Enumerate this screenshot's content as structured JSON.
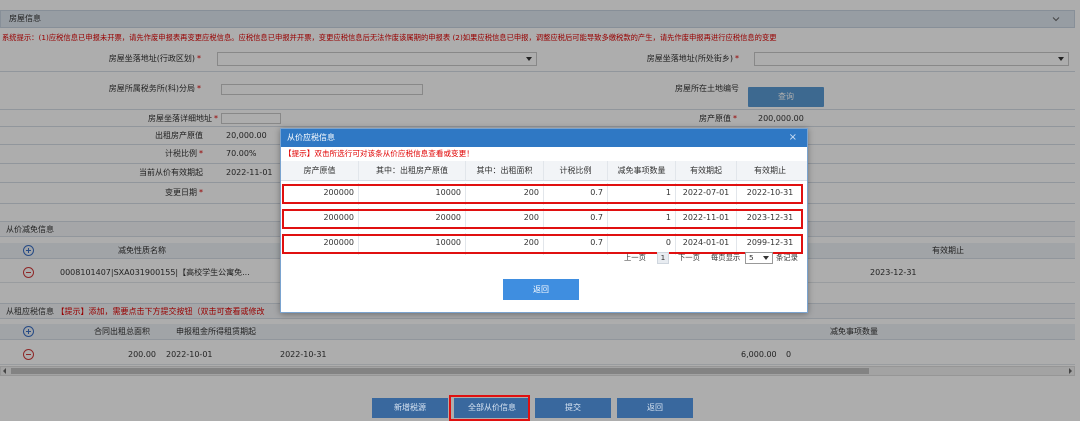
{
  "house_section": {
    "title": "房屋信息",
    "notice": "系统提示：(1)应税信息已申报未开票，请先作废申报表再变更应税信息。应税信息已申报并开票，变更应税信息后无法作废该属期的申报表 (2)如果应税信息已申报，调整应税后可能导致多缴税款的产生，请先作废申报再进行应税信息的变更",
    "fields": {
      "location_district_label": "房屋坐落地址(行政区划)",
      "location_street_label": "房屋坐落地址(所处街乡)",
      "tax_office_label": "房屋所属税务所(科)分局",
      "land_no_label": "房屋所在土地编号",
      "query_button": "查询",
      "detail_address_label": "房屋坐落详细地址",
      "original_value_label": "房产原值",
      "original_value": "200,000.00",
      "rented_original_label": "出租房产原值",
      "rented_original": "20,000.00",
      "deduction_ratio_label": "计税比例",
      "deduction_ratio": "70.00%",
      "effective_start_label": "当前从价有效期起",
      "effective_start": "2022-11-01",
      "change_date_label": "变更日期"
    }
  },
  "exemption_section": {
    "title": "从价减免信息",
    "col_nature": "减免性质名称",
    "col_end": "有效期止",
    "row": {
      "nature": "0008101407|SXA031900155|【高校学生公寓免...",
      "end": "2023-12-31"
    }
  },
  "rent_section": {
    "title_prefix": "从租应税信息",
    "title_tip": "【提示】添加，需要点击下方提交按钮（双击可查看或修改",
    "col_total_area": "合同出租总面积",
    "col_rent_start": "申报租金所得租赁期起",
    "col_reduce_count": "减免事项数量",
    "row": {
      "area": "200.00",
      "start": "2022-10-01",
      "end": "2022-10-31",
      "amount": "6,000.00",
      "count": "0"
    }
  },
  "modal": {
    "title": "从价应税信息",
    "tip": "【提示】双击所选行可对该条从价应税信息查看或变更！",
    "headers": [
      "房产原值",
      "其中：出租房产原值",
      "其中：出租面积",
      "计税比例",
      "减免事项数量",
      "有效期起",
      "有效期止"
    ],
    "rows": [
      [
        "200000",
        "10000",
        "200",
        "0.7",
        "1",
        "2022-07-01",
        "2022-10-31"
      ],
      [
        "200000",
        "20000",
        "200",
        "0.7",
        "1",
        "2022-11-01",
        "2023-12-31"
      ],
      [
        "200000",
        "10000",
        "200",
        "0.7",
        "0",
        "2024-01-01",
        "2099-12-31"
      ]
    ],
    "pager": {
      "prev": "上一页",
      "current": "1",
      "next": "下一页",
      "per_page_label": "每页显示",
      "per_page": "5",
      "unit": "条记录"
    },
    "back_button": "返回"
  },
  "toolbar": {
    "add_button": "新增税源",
    "all_price_button": "全部从价信息",
    "submit_button": "提交",
    "back_button": "返回"
  },
  "colors": {
    "accent": "#2f78c4",
    "highlight": "#e01010",
    "notice": "#e00000"
  }
}
